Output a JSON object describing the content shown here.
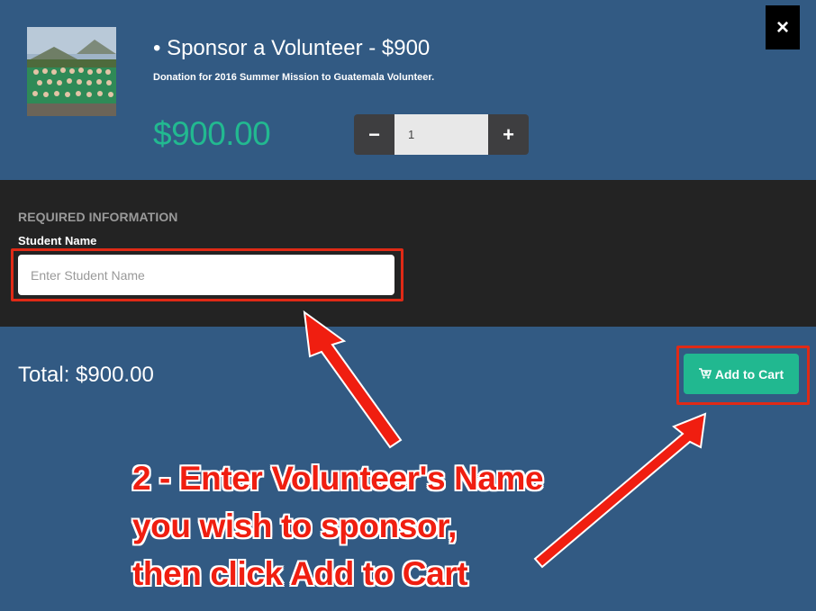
{
  "modal": {
    "close_label": "×",
    "product": {
      "title": "• Sponsor a Volunteer - $900",
      "description": "Donation for 2016 Summer Mission to Guatemala Volunteer.",
      "price": "$900.00",
      "thumbnail": "group-photo"
    },
    "quantity": {
      "minus_label": "−",
      "value": "1",
      "plus_label": "+"
    },
    "required_info": {
      "heading": "REQUIRED INFORMATION",
      "field_label": "Student Name",
      "field_placeholder": "Enter Student Name",
      "field_value": ""
    },
    "footer": {
      "total_text": "Total: $900.00",
      "add_to_cart_label": "Add to Cart",
      "cart_icon": "cart-plus-icon"
    }
  },
  "annotation": {
    "lines": [
      "2 - Enter Volunteer's Name",
      "you wish to sponsor,",
      "then click  Add to Cart"
    ],
    "color": "#f01e10",
    "highlight_color": "#e02a16"
  },
  "colors": {
    "modal_bg": "#325a83",
    "section_bg": "#232323",
    "accent_green": "#22b990",
    "stepper_bg": "#3e3e40"
  }
}
